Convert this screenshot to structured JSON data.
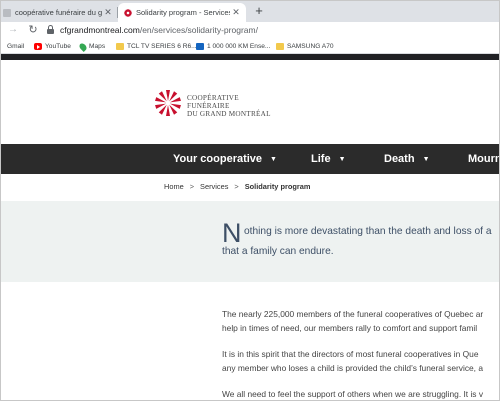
{
  "browser": {
    "tabs": [
      {
        "title": "coopérative funéraire du grand m",
        "active": false
      },
      {
        "title": "Solidarity program - Services |",
        "active": true
      }
    ],
    "new_tab": "+",
    "close_glyph": "✕",
    "url_host": "cfgrandmontreal.com",
    "url_path": "/en/services/solidarity-program/",
    "bookmarks": [
      {
        "label": "Gmail",
        "icon": "gmail-icon"
      },
      {
        "label": "YouTube",
        "icon": "youtube-icon"
      },
      {
        "label": "Maps",
        "icon": "maps-icon"
      },
      {
        "label": "TCL TV SERIES 6 R6...",
        "icon": "folder-icon"
      },
      {
        "label": "1 000 000 KM Ense...",
        "icon": "site-icon"
      },
      {
        "label": "SAMSUNG A70",
        "icon": "folder-icon"
      }
    ]
  },
  "site": {
    "logo": {
      "line1": "COOPÉRATIVE",
      "line2": "FUNÉRAIRE",
      "line3": "DU GRAND MONTRÉAL",
      "color": "#c8102e"
    },
    "nav": [
      {
        "label": "Your cooperative",
        "caret": "▼"
      },
      {
        "label": "Life",
        "caret": "▼"
      },
      {
        "label": "Death",
        "caret": "▼"
      },
      {
        "label": "Mourn"
      }
    ],
    "breadcrumb": {
      "home": "Home",
      "section": "Services",
      "current": "Solidarity program",
      "sep": ">"
    },
    "intro": {
      "dropcap": "N",
      "line1": "othing is more devastating than the death and loss of a",
      "line2": "that a family can endure."
    },
    "paragraphs": [
      "The nearly 225,000 members of the funeral cooperatives of Quebec ar",
      "help in times of need, our members rally to comfort and support famil",
      "It is in this spirit that the directors of most funeral cooperatives in Que",
      "any member who loses a child is provided the child’s funeral service, a",
      "We all need to feel the support of others when we are struggling. It is v"
    ]
  }
}
